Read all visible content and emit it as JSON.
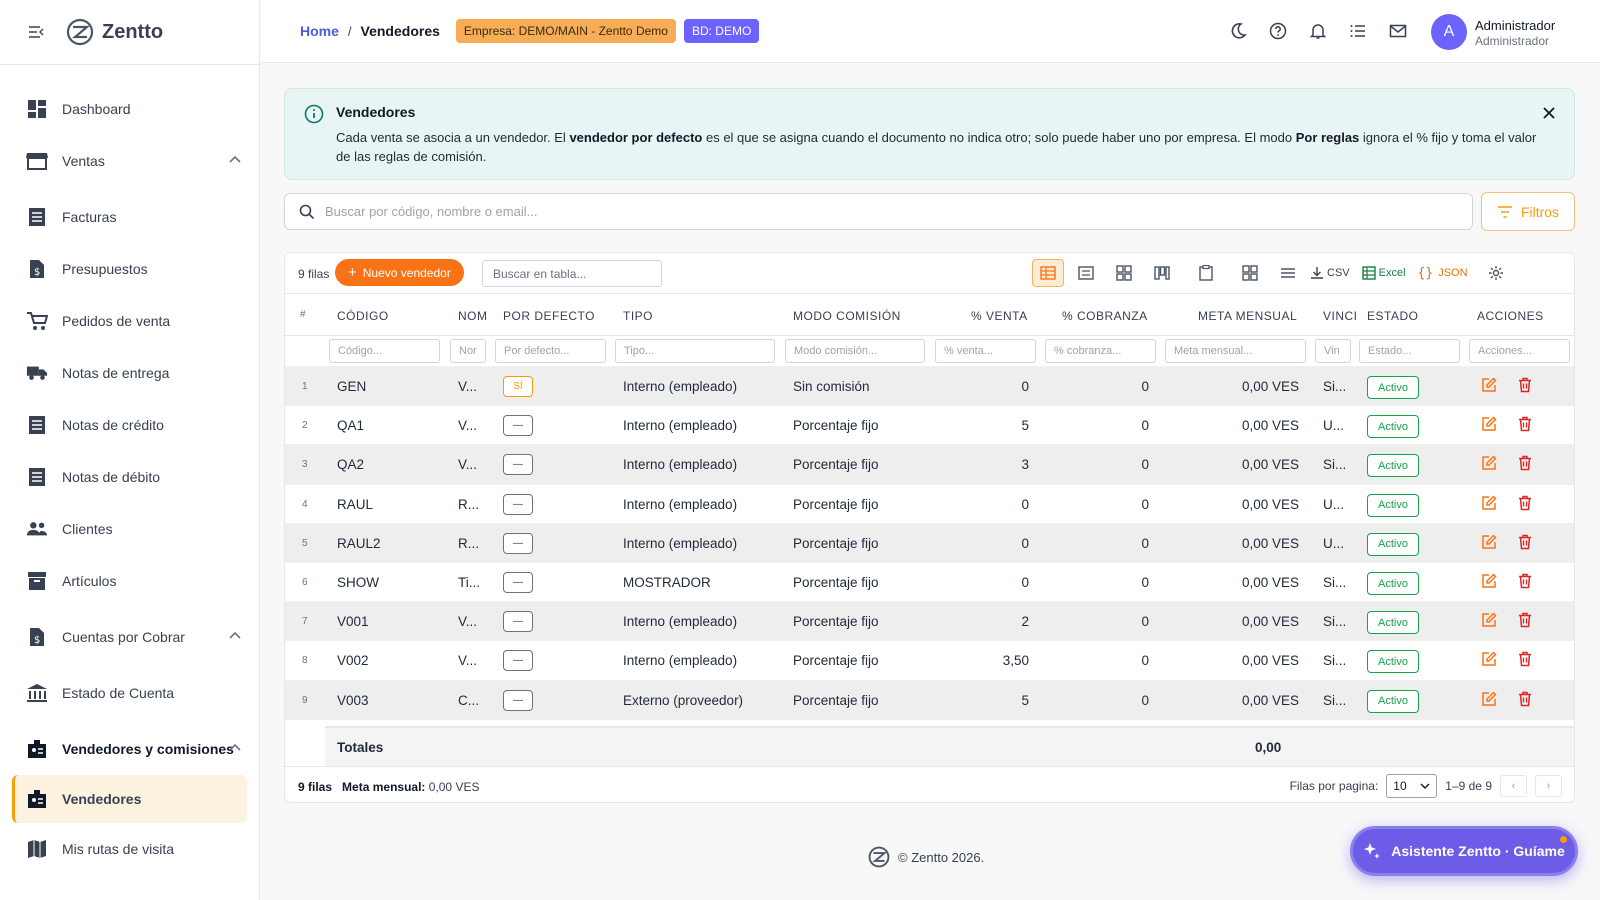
{
  "app": {
    "brand": "Zentto"
  },
  "sidebar": {
    "items": [
      {
        "label": "Dashboard"
      },
      {
        "label": "Ventas"
      },
      {
        "label": "Facturas"
      },
      {
        "label": "Presupuestos"
      },
      {
        "label": "Pedidos de venta"
      },
      {
        "label": "Notas de entrega"
      },
      {
        "label": "Notas de crédito"
      },
      {
        "label": "Notas de débito"
      },
      {
        "label": "Clientes"
      },
      {
        "label": "Artículos"
      },
      {
        "label": "Cuentas por Cobrar"
      },
      {
        "label": "Estado de Cuenta"
      },
      {
        "label": "Vendedores y comisiones"
      },
      {
        "label": "Vendedores"
      },
      {
        "label": "Mis rutas de visita"
      }
    ]
  },
  "header": {
    "breadcrumb_home": "Home",
    "breadcrumb_sep": "/",
    "breadcrumb_current": "Vendedores",
    "empresa_badge": "Empresa: DEMO/MAIN - Zentto Demo",
    "db_badge": "BD: DEMO",
    "user_initial": "A",
    "user_name": "Administrador",
    "user_role": "Administrador"
  },
  "info": {
    "title": "Vendedores",
    "text_1": "Cada venta se asocia a un vendedor. El ",
    "bold_1": "vendedor por defecto",
    "text_2": " es el que se asigna cuando el documento no indica otro; solo puede haber uno por empresa. El modo ",
    "bold_2": "Por reglas",
    "text_3": " ignora el % fijo y toma el valor de las reglas de comisión."
  },
  "search": {
    "placeholder": "Buscar por código, nombre o email...",
    "filters_label": "Filtros"
  },
  "toolbar": {
    "rows_count": "9 filas",
    "new_label": "Nuevo vendedor",
    "table_search_placeholder": "Buscar en tabla...",
    "csv": "CSV",
    "excel": "Excel",
    "json": "JSON"
  },
  "table": {
    "columns": [
      "#",
      "CÓDIGO",
      "NOM",
      "POR DEFECTO",
      "TIPO",
      "MODO COMISIÓN",
      "% VENTA",
      "% COBRANZA",
      "META MENSUAL",
      "VINCI",
      "ESTADO",
      "ACCIONES"
    ],
    "filter_placeholders": [
      "Código...",
      "Nor",
      "Por defecto...",
      "Tipo...",
      "Modo comisión...",
      "% venta...",
      "% cobranza...",
      "Meta mensual...",
      "Vin",
      "Estado...",
      "Acciones..."
    ],
    "rows": [
      {
        "n": "1",
        "codigo": "GEN",
        "nombre": "V...",
        "defecto": "SÍ",
        "tipo": "Interno (empleado)",
        "modo": "Sin comisión",
        "venta": "0",
        "cobranza": "0",
        "meta": "0,00 VES",
        "vinc": "Si...",
        "estado": "Activo"
      },
      {
        "n": "2",
        "codigo": "QA1",
        "nombre": "V...",
        "defecto": "—",
        "tipo": "Interno (empleado)",
        "modo": "Porcentaje fijo",
        "venta": "5",
        "cobranza": "0",
        "meta": "0,00 VES",
        "vinc": "U...",
        "estado": "Activo"
      },
      {
        "n": "3",
        "codigo": "QA2",
        "nombre": "V...",
        "defecto": "—",
        "tipo": "Interno (empleado)",
        "modo": "Porcentaje fijo",
        "venta": "3",
        "cobranza": "0",
        "meta": "0,00 VES",
        "vinc": "Si...",
        "estado": "Activo"
      },
      {
        "n": "4",
        "codigo": "RAUL",
        "nombre": "R...",
        "defecto": "—",
        "tipo": "Interno (empleado)",
        "modo": "Porcentaje fijo",
        "venta": "0",
        "cobranza": "0",
        "meta": "0,00 VES",
        "vinc": "U...",
        "estado": "Activo"
      },
      {
        "n": "5",
        "codigo": "RAUL2",
        "nombre": "R...",
        "defecto": "—",
        "tipo": "Interno (empleado)",
        "modo": "Porcentaje fijo",
        "venta": "0",
        "cobranza": "0",
        "meta": "0,00 VES",
        "vinc": "U...",
        "estado": "Activo"
      },
      {
        "n": "6",
        "codigo": "SHOW",
        "nombre": "Ti...",
        "defecto": "—",
        "tipo": "MOSTRADOR",
        "modo": "Porcentaje fijo",
        "venta": "0",
        "cobranza": "0",
        "meta": "0,00 VES",
        "vinc": "Si...",
        "estado": "Activo"
      },
      {
        "n": "7",
        "codigo": "V001",
        "nombre": "V...",
        "defecto": "—",
        "tipo": "Interno (empleado)",
        "modo": "Porcentaje fijo",
        "venta": "2",
        "cobranza": "0",
        "meta": "0,00 VES",
        "vinc": "Si...",
        "estado": "Activo"
      },
      {
        "n": "8",
        "codigo": "V002",
        "nombre": "V...",
        "defecto": "—",
        "tipo": "Interno (empleado)",
        "modo": "Porcentaje fijo",
        "venta": "3,50",
        "cobranza": "0",
        "meta": "0,00 VES",
        "vinc": "Si...",
        "estado": "Activo"
      },
      {
        "n": "9",
        "codigo": "V003",
        "nombre": "C...",
        "defecto": "—",
        "tipo": "Externo (proveedor)",
        "modo": "Porcentaje fijo",
        "venta": "5",
        "cobranza": "0",
        "meta": "0,00 VES",
        "vinc": "Si...",
        "estado": "Activo"
      }
    ],
    "totals_label": "Totales",
    "totals_value": "0,00"
  },
  "footer": {
    "rows": "9 filas",
    "meta_label": "Meta mensual:",
    "meta_value": "0,00 VES",
    "per_page_label": "Filas por pagina:",
    "per_page_value": "10",
    "range": "1–9 de 9",
    "prev": "‹",
    "next": "›"
  },
  "copyright": "© Zentto 2026.",
  "assistant": {
    "label": "Asistente Zentto · Guíame"
  },
  "colors": {
    "accent": "#f97316",
    "brand_purple": "#6c63ff",
    "success": "#16a34a",
    "danger": "#dc2626"
  }
}
